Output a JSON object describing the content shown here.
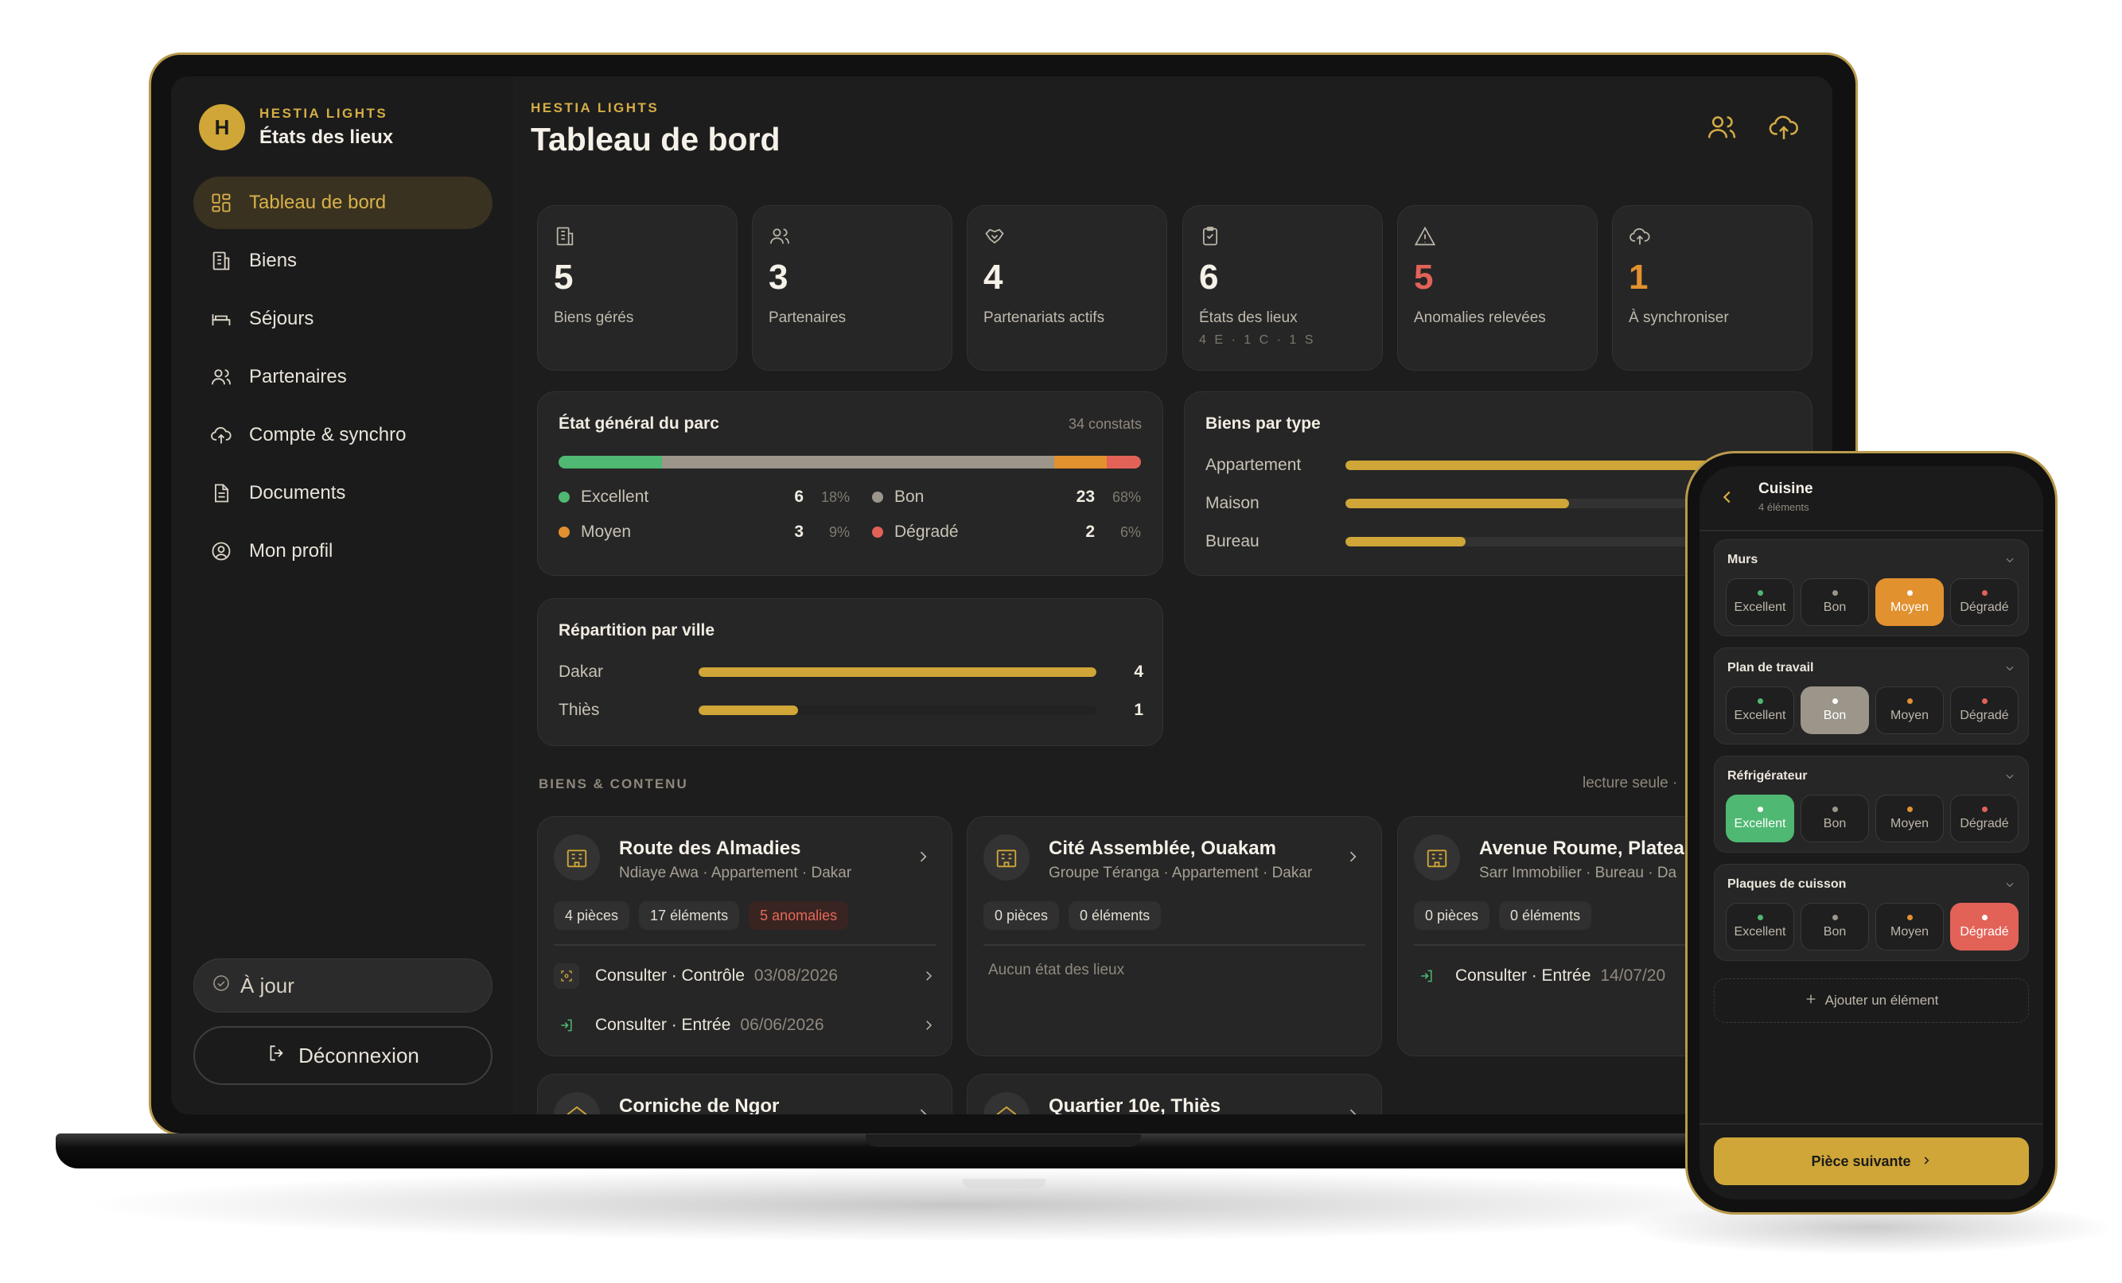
{
  "colors": {
    "accent": "#cfa637",
    "excellent": "#4fb872",
    "bon": "#9b958a",
    "moyen": "#e2912f",
    "degrade": "#e26258",
    "background": "#1d1d1d"
  },
  "sidebar": {
    "brand_kicker": "HESTIA LIGHTS",
    "brand_title": "États des lieux",
    "brand_initial": "H",
    "items": [
      {
        "label": "Tableau de bord",
        "icon": "dashboard-icon",
        "active": true
      },
      {
        "label": "Biens",
        "icon": "building-icon",
        "active": false
      },
      {
        "label": "Séjours",
        "icon": "bed-icon",
        "active": false
      },
      {
        "label": "Partenaires",
        "icon": "users-icon",
        "active": false
      },
      {
        "label": "Compte & synchro",
        "icon": "cloud-sync-icon",
        "active": false
      },
      {
        "label": "Documents",
        "icon": "document-icon",
        "active": false
      },
      {
        "label": "Mon profil",
        "icon": "profile-icon",
        "active": false
      }
    ],
    "status_label": "À jour",
    "logout_label": "Déconnexion"
  },
  "header": {
    "kicker": "HESTIA LIGHTS",
    "title": "Tableau de bord"
  },
  "stats": [
    {
      "value": "5",
      "label": "Biens gérés",
      "sub": "",
      "icon": "building-icon",
      "highlight": false
    },
    {
      "value": "3",
      "label": "Partenaires",
      "sub": "",
      "icon": "users-icon",
      "highlight": false
    },
    {
      "value": "4",
      "label": "Partenariats actifs",
      "sub": "",
      "icon": "handshake-icon",
      "highlight": false
    },
    {
      "value": "6",
      "label": "États des lieux",
      "sub": "4 E · 1 C · 1 S",
      "icon": "clipboard-icon",
      "highlight": false
    },
    {
      "value": "5",
      "label": "Anomalies relevées",
      "sub": "",
      "icon": "warning-icon",
      "highlight": "#e26258"
    },
    {
      "value": "1",
      "label": "À synchroniser",
      "sub": "",
      "icon": "cloud-upload-icon",
      "highlight": "#e2912f"
    }
  ],
  "etat_parc": {
    "title": "État général du parc",
    "meta": "34 constats",
    "legend": [
      {
        "name": "Excellent",
        "count": "6",
        "pct": "18%",
        "share": 18,
        "color": "#4fb872"
      },
      {
        "name": "Bon",
        "count": "23",
        "pct": "68%",
        "share": 68,
        "color": "#9b958a"
      },
      {
        "name": "Moyen",
        "count": "3",
        "pct": "9%",
        "share": 9,
        "color": "#e2912f"
      },
      {
        "name": "Dégradé",
        "count": "2",
        "pct": "6%",
        "share": 6,
        "color": "#e26258"
      }
    ]
  },
  "biens_par_type": {
    "title": "Biens par type",
    "rows": [
      {
        "label": "Appartement",
        "fraction": 1.0
      },
      {
        "label": "Maison",
        "fraction": 0.52
      },
      {
        "label": "Bureau",
        "fraction": 0.28
      }
    ]
  },
  "repartition_ville": {
    "title": "Répartition par ville",
    "rows": [
      {
        "label": "Dakar",
        "value": "4",
        "fraction": 1.0
      },
      {
        "label": "Thiès",
        "value": "1",
        "fraction": 0.25
      }
    ]
  },
  "section": {
    "label": "BIENS & CONTENU",
    "meta": "lecture seule ·"
  },
  "properties": [
    {
      "name": "Route des Almadies",
      "sub": "Ndiaye Awa · Appartement · Dakar",
      "chips": [
        "4 pièces",
        "17 éléments",
        "5 anomalies"
      ],
      "empty": "",
      "lines": [
        {
          "label": "Consulter · Contrôle",
          "date": "03/08/2026",
          "icon": "scan-icon"
        },
        {
          "label": "Consulter · Entrée",
          "date": "06/06/2026",
          "icon": "enter-icon"
        }
      ]
    },
    {
      "name": "Cité Assemblée, Ouakam",
      "sub": "Groupe Téranga · Appartement · Dakar",
      "chips": [
        "0 pièces",
        "0 éléments"
      ],
      "empty": "Aucun état des lieux",
      "lines": []
    },
    {
      "name": "Avenue Roume, Platea",
      "sub": "Sarr Immobilier · Bureau · Da",
      "chips": [
        "0 pièces",
        "0 éléments"
      ],
      "empty": "",
      "lines": [
        {
          "label": "Consulter · Entrée",
          "date": "14/07/20",
          "icon": "enter-icon"
        }
      ]
    },
    {
      "name": "Corniche de Ngor",
      "sub": "",
      "chips": [],
      "empty": "",
      "lines": []
    },
    {
      "name": "Quartier 10e, Thiès",
      "sub": "",
      "chips": [],
      "empty": "",
      "lines": []
    }
  ],
  "phone": {
    "title": "Cuisine",
    "subtitle": "4 éléments",
    "option_labels": [
      "Excellent",
      "Bon",
      "Moyen",
      "Dégradé"
    ],
    "elements": [
      {
        "name": "Murs",
        "selected": 2
      },
      {
        "name": "Plan de travail",
        "selected": 1
      },
      {
        "name": "Réfrigérateur",
        "selected": 0
      },
      {
        "name": "Plaques de cuisson",
        "selected": 3
      }
    ],
    "add_label": "Ajouter un élément",
    "next_label": "Pièce suivante"
  }
}
